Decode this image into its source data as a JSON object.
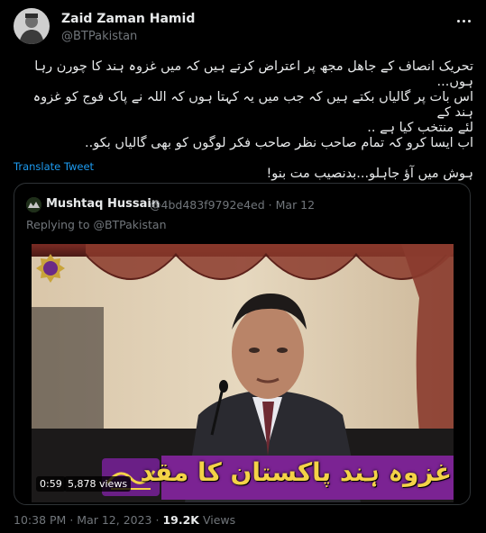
{
  "tweet": {
    "author_name": "Zaid Zaman Hamid",
    "author_handle": "@BTPakistan",
    "text_lines": [
      "تحریک انصاف کے جاھل مجھ پر اعتراض کرتے ہیں کہ میں غزوہ ہند کا چورن رہا ہوں...",
      "اس بات پر گالیاں بکتے ہیں کہ جب میں یہ کہتا ہوں کہ اللہ نے پاک فوج کو غزوہ ہند کے",
      "لئے منتخب کیا ہے ..",
      "اب ایسا کرو کہ تمام صاحب نظر صاحب فکر لوگوں کو بھی گالیاں بکو..",
      "ہوش میں آؤ جاہلو...بدنصیب مت بنو!"
    ],
    "translate_label": "Translate Tweet",
    "footer": {
      "time": "10:38 PM",
      "sep": "·",
      "date": "Mar 12, 2023",
      "views_count": "19.2K",
      "views_label": "Views"
    }
  },
  "quote": {
    "author_name": "Mushtaq Hussain",
    "author_handle": "@4bd483f9792e4ed",
    "sep": "·",
    "date": "Mar 12",
    "replying_to": "Replying to @BTPakistan",
    "video": {
      "timestamp": "0:59",
      "views": "5,878 views",
      "caption": "غزوہ ہند پاکستان کا مقد"
    }
  },
  "icons": {
    "more": "more-dots-icon"
  },
  "colors": {
    "background": "#000000",
    "text": "#e7e9ea",
    "muted": "#71767b",
    "link": "#1d9bf0",
    "border": "#2f3336",
    "caption_bg": "#7b2393",
    "caption_text": "#f4d247"
  }
}
